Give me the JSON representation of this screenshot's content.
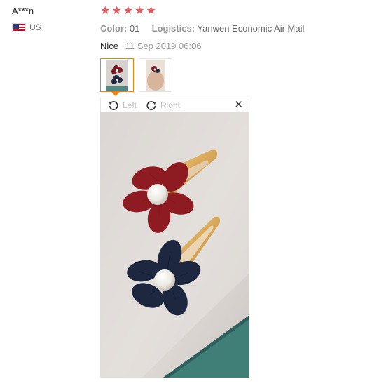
{
  "reviewer": {
    "name": "A***n",
    "country": "US",
    "flag_icon": "us-flag-icon"
  },
  "rating": {
    "stars": 5,
    "star_color": "#f0565f",
    "star_glyph": "★"
  },
  "meta": {
    "color_label": "Color:",
    "color_value": "01",
    "logistics_label": "Logistics:",
    "logistics_value": "Yanwen Economic Air Mail"
  },
  "review": {
    "text": "Nice",
    "date": "11 Sep 2019 06:06"
  },
  "viewer": {
    "rotate_left_label": "Left",
    "rotate_right_label": "Right",
    "close_glyph": "✕",
    "selected_thumbnail": 1,
    "accent_color": "#f08300"
  },
  "photo": {
    "subject": "two flower hair clips with pearl centers"
  }
}
